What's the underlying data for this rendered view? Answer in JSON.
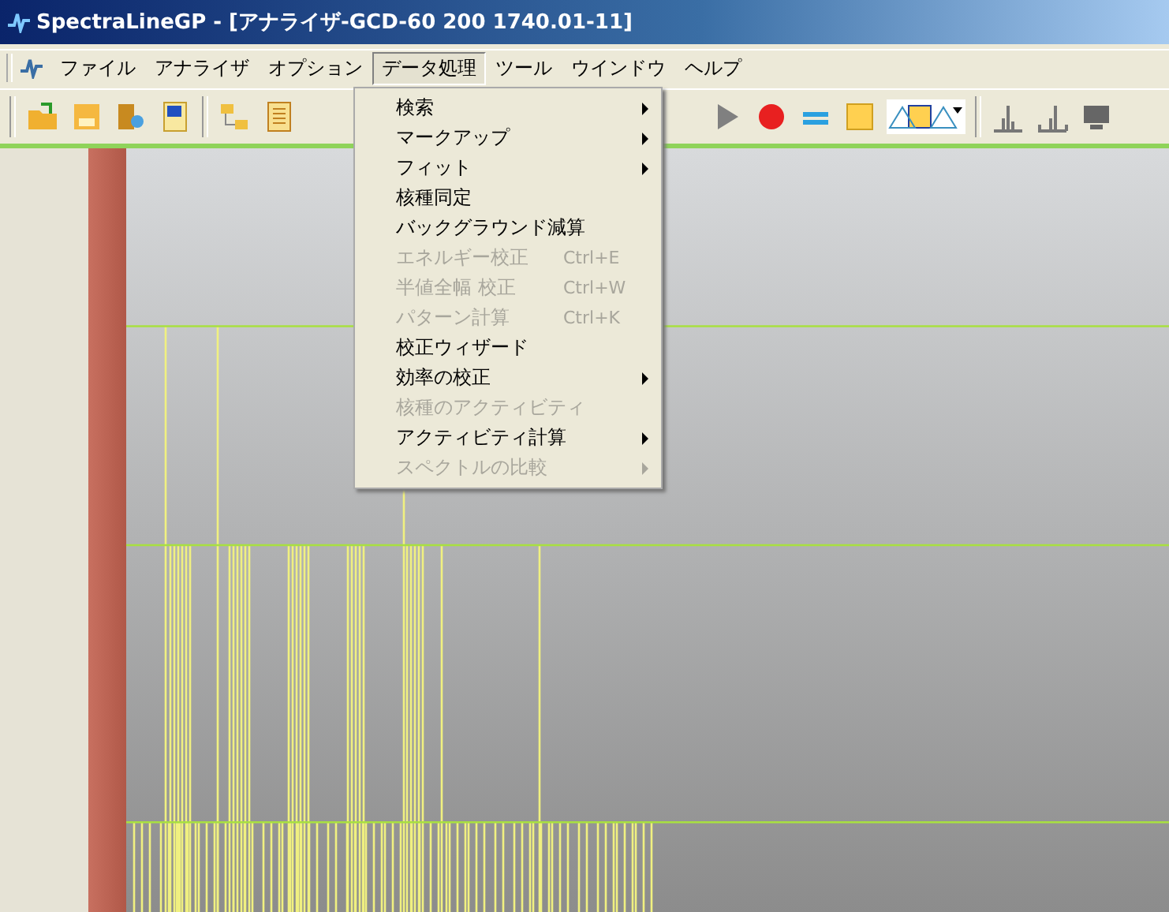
{
  "window": {
    "title": "SpectraLineGP - [アナライザ-GCD-60 200 1740.01-11]"
  },
  "menubar": {
    "items": [
      {
        "label": "ファイル",
        "selected": false
      },
      {
        "label": "アナライザ",
        "selected": false
      },
      {
        "label": "オプション",
        "selected": false
      },
      {
        "label": "データ処理",
        "selected": true
      },
      {
        "label": "ツール",
        "selected": false
      },
      {
        "label": "ウインドウ",
        "selected": false
      },
      {
        "label": "ヘルプ",
        "selected": false
      }
    ]
  },
  "menu": {
    "items": [
      {
        "label": "検索",
        "disabled": false,
        "submenu": true
      },
      {
        "label": "マークアップ",
        "disabled": false,
        "submenu": true
      },
      {
        "label": "フィット",
        "disabled": false,
        "submenu": true
      },
      {
        "label": "核種同定",
        "disabled": false,
        "submenu": false
      },
      {
        "label": "バックグラウンド減算",
        "disabled": false,
        "submenu": false
      },
      {
        "label": "エネルギー校正",
        "disabled": true,
        "submenu": false,
        "shortcut": "Ctrl+E"
      },
      {
        "label": "半値全幅 校正",
        "disabled": true,
        "submenu": false,
        "shortcut": "Ctrl+W"
      },
      {
        "label": "パターン計算",
        "disabled": true,
        "submenu": false,
        "shortcut": "Ctrl+K"
      },
      {
        "label": "校正ウィザード",
        "disabled": false,
        "submenu": false
      },
      {
        "label": "効率の校正",
        "disabled": false,
        "submenu": true
      },
      {
        "label": "核種のアクティビティ",
        "disabled": true,
        "submenu": false
      },
      {
        "label": "アクティビティ計算",
        "disabled": false,
        "submenu": true
      },
      {
        "label": "スペクトルの比較",
        "disabled": true,
        "submenu": true
      }
    ]
  }
}
